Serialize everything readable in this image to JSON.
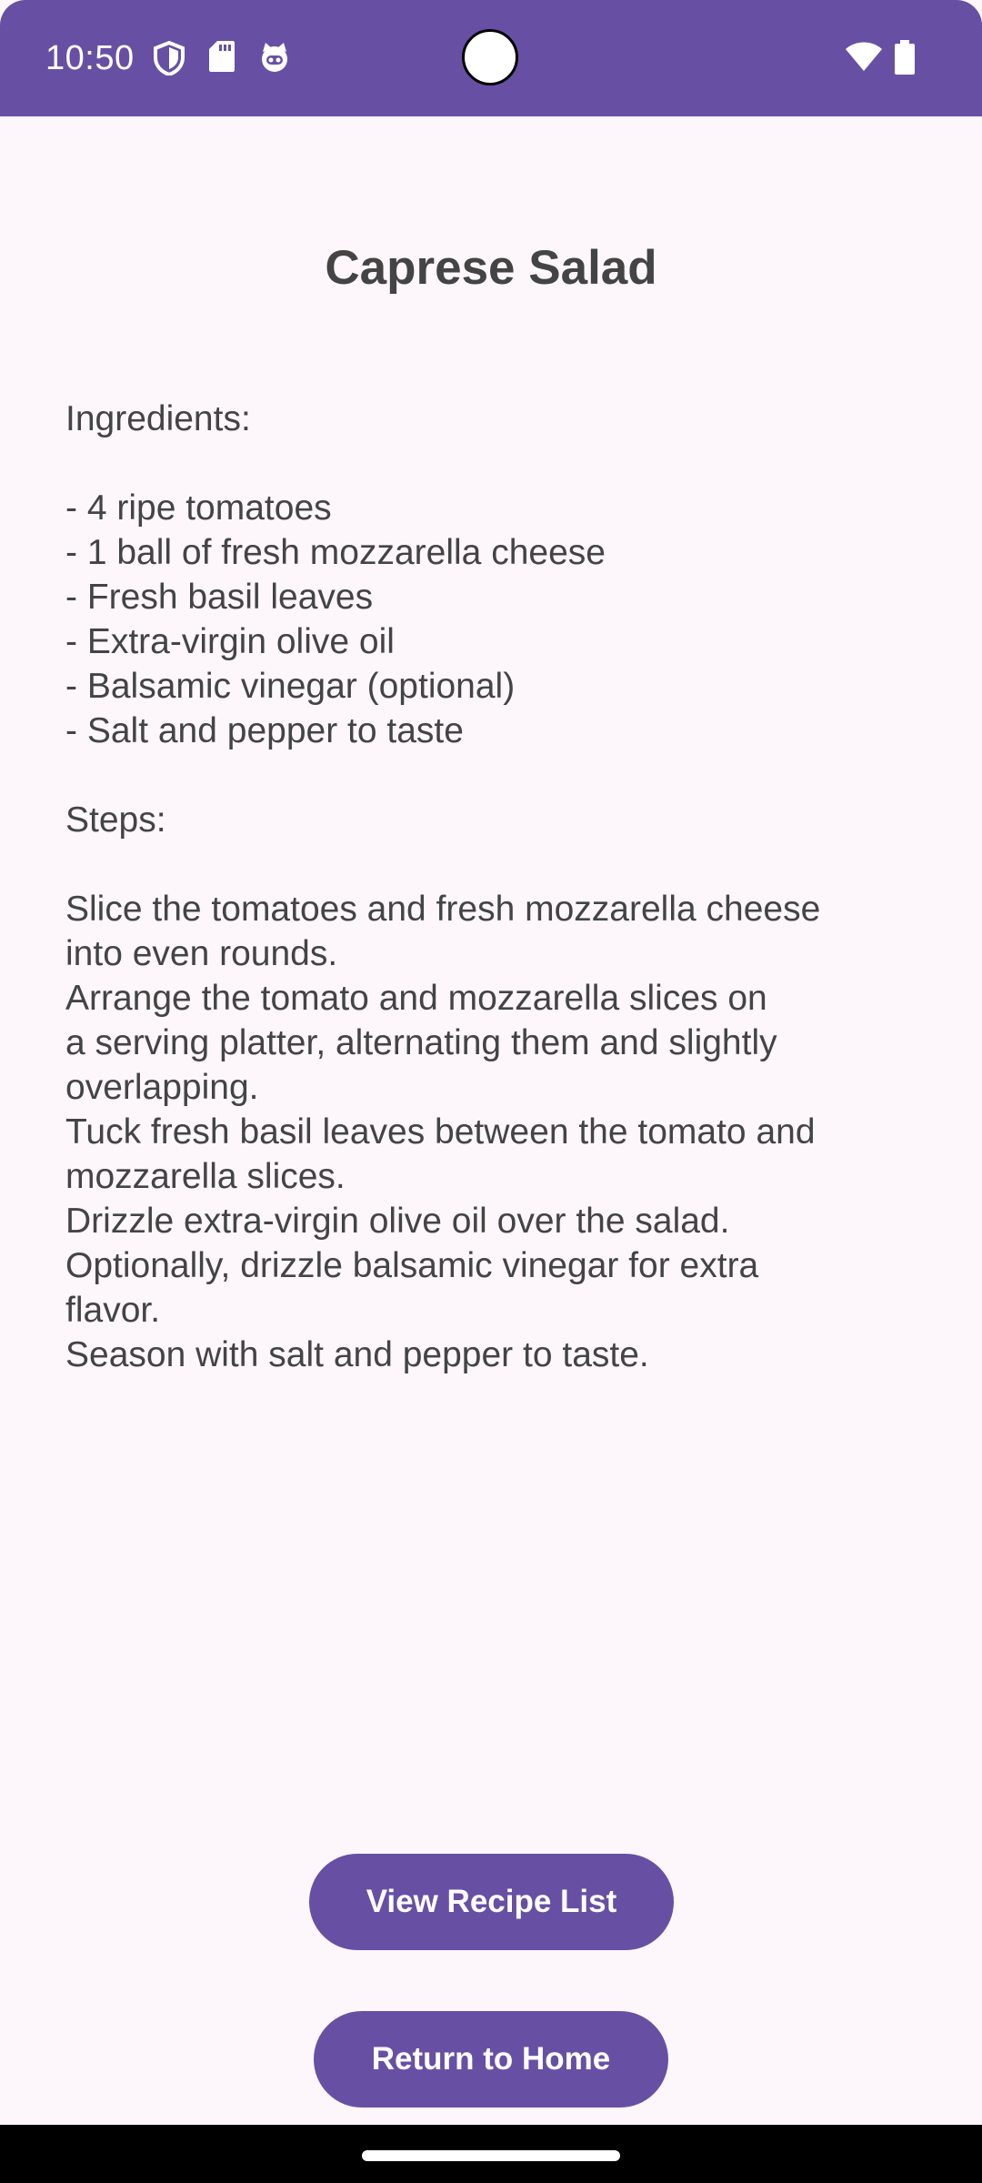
{
  "status_bar": {
    "time": "10:50",
    "icons_left": [
      "shield-icon",
      "sd-card-icon",
      "cat-face-icon"
    ],
    "icons_right": [
      "wifi-icon",
      "battery-icon"
    ],
    "color": "#6750a4"
  },
  "recipe": {
    "title": "Caprese Salad",
    "ingredients_heading": "Ingredients:",
    "ingredients": [
      "- 4 ripe tomatoes",
      "- 1 ball of fresh mozzarella cheese",
      "- Fresh basil leaves",
      "- Extra-virgin olive oil",
      "- Balsamic vinegar (optional)",
      "- Salt and pepper to taste"
    ],
    "steps_heading": "Steps:",
    "steps_lines": [
      "Slice the tomatoes and fresh mozzarella cheese",
      "into even rounds.",
      "Arrange the tomato and mozzarella slices on",
      "a serving platter, alternating them and slightly",
      "overlapping.",
      "Tuck fresh basil leaves between the tomato and",
      "mozzarella slices.",
      "Drizzle extra-virgin olive oil over the salad.",
      "Optionally, drizzle balsamic vinegar for extra",
      "flavor.",
      "Season with salt and pepper to taste."
    ]
  },
  "buttons": {
    "view_recipe_list": "View Recipe List",
    "return_home": "Return to Home"
  },
  "colors": {
    "accent": "#6750a4",
    "background": "#fdf7fb",
    "text": "#444444"
  }
}
